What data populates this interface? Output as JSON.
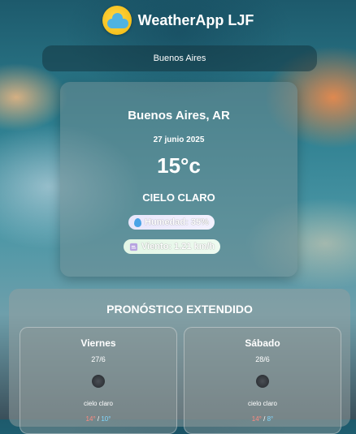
{
  "header": {
    "title": "WeatherApp LJF",
    "logo_icon": "partly-cloudy-sun-icon"
  },
  "search": {
    "city": "Buenos Aires"
  },
  "current": {
    "city": "Buenos Aires, AR",
    "date": "27 junio 2025",
    "temperature": "15°c",
    "description": "CIELO CLARO",
    "humidity": "Humedad: 35%",
    "wind": "Viento: 1.21 km/h"
  },
  "forecast": {
    "title": "PRONÓSTICO EXTENDIDO",
    "days": [
      {
        "name": "Viernes",
        "date": "27/6",
        "description": "cielo claro",
        "icon": "clear-sky-icon",
        "max": "14°",
        "min": "10°"
      },
      {
        "name": "Sábado",
        "date": "28/6",
        "description": "cielo claro",
        "icon": "clear-sky-icon",
        "max": "14°",
        "min": "8°"
      }
    ]
  },
  "colors": {
    "max_temp": "#ff8a80",
    "min_temp": "#7fd8ff"
  }
}
